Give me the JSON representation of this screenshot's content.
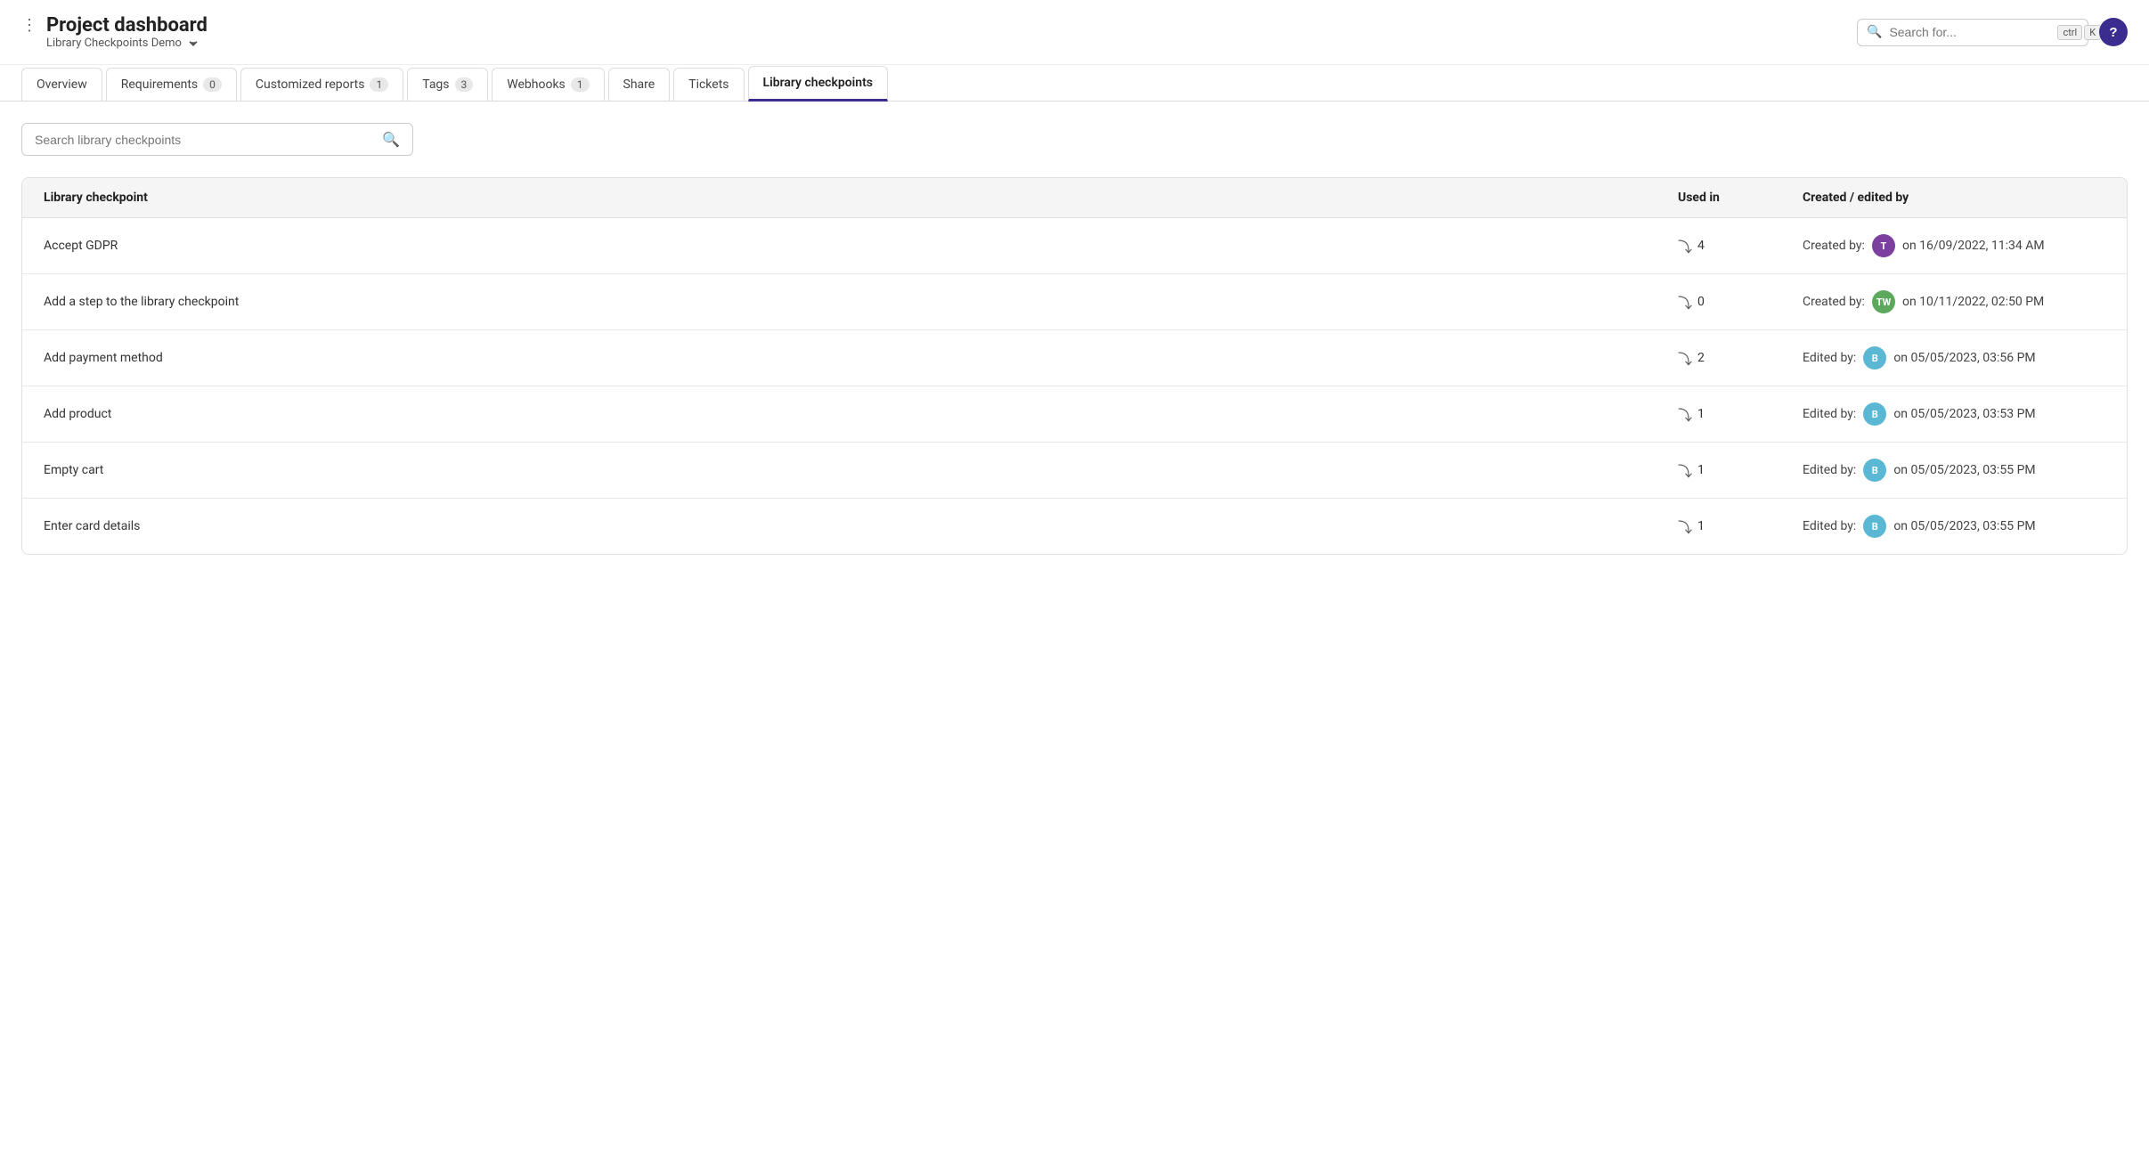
{
  "header": {
    "title": "Project dashboard",
    "subtitle": "Library Checkpoints Demo",
    "search_placeholder": "Search for...",
    "kbd1": "ctrl",
    "kbd2": "K",
    "help_label": "?"
  },
  "tabs": [
    {
      "id": "overview",
      "label": "Overview",
      "badge": null,
      "active": false
    },
    {
      "id": "requirements",
      "label": "Requirements",
      "badge": "0",
      "active": false
    },
    {
      "id": "customized-reports",
      "label": "Customized reports",
      "badge": "1",
      "active": false
    },
    {
      "id": "tags",
      "label": "Tags",
      "badge": "3",
      "active": false
    },
    {
      "id": "webhooks",
      "label": "Webhooks",
      "badge": "1",
      "active": false
    },
    {
      "id": "share",
      "label": "Share",
      "badge": null,
      "active": false
    },
    {
      "id": "tickets",
      "label": "Tickets",
      "badge": null,
      "active": false
    },
    {
      "id": "library-checkpoints",
      "label": "Library checkpoints",
      "badge": null,
      "active": true
    }
  ],
  "library_search": {
    "placeholder": "Search library checkpoints"
  },
  "table": {
    "columns": [
      {
        "id": "name",
        "label": "Library checkpoint"
      },
      {
        "id": "used_in",
        "label": "Used in"
      },
      {
        "id": "created_edited",
        "label": "Created / edited by"
      }
    ],
    "rows": [
      {
        "name": "Accept GDPR",
        "used_in": 4,
        "action": "Created by:",
        "avatar_initials": "T",
        "avatar_color": "purple",
        "date": "on 16/09/2022, 11:34 AM"
      },
      {
        "name": "Add a step to the library checkpoint",
        "used_in": 0,
        "action": "Created by:",
        "avatar_initials": "TW",
        "avatar_color": "green",
        "date": "on 10/11/2022, 02:50 PM"
      },
      {
        "name": "Add payment method",
        "used_in": 2,
        "action": "Edited by:",
        "avatar_initials": "B",
        "avatar_color": "blue",
        "date": "on 05/05/2023, 03:56 PM"
      },
      {
        "name": "Add product",
        "used_in": 1,
        "action": "Edited by:",
        "avatar_initials": "B",
        "avatar_color": "blue",
        "date": "on 05/05/2023, 03:53 PM"
      },
      {
        "name": "Empty cart",
        "used_in": 1,
        "action": "Edited by:",
        "avatar_initials": "B",
        "avatar_color": "blue",
        "date": "on 05/05/2023, 03:55 PM"
      },
      {
        "name": "Enter card details",
        "used_in": 1,
        "action": "Edited by:",
        "avatar_initials": "B",
        "avatar_color": "blue",
        "date": "on 05/05/2023, 03:55 PM"
      }
    ]
  }
}
